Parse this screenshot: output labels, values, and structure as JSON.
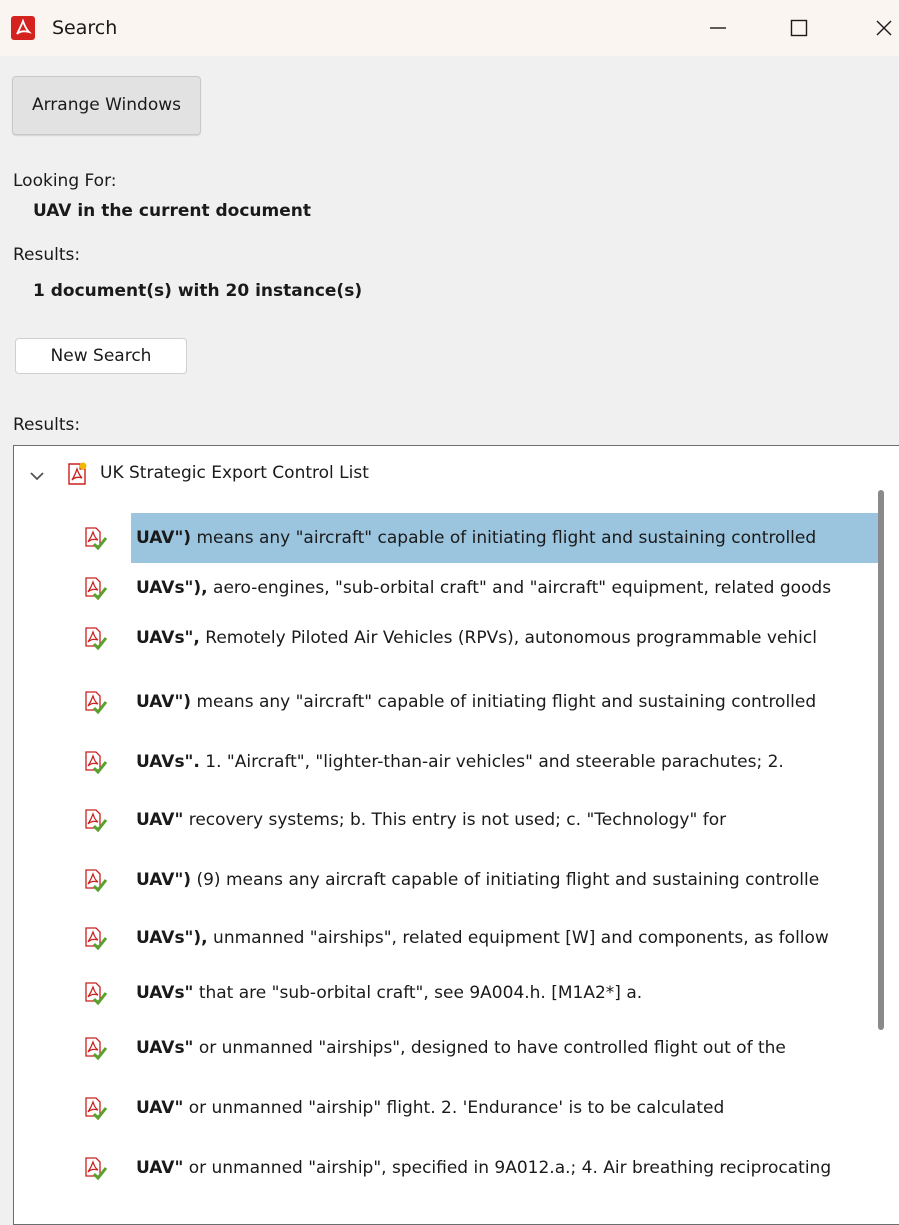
{
  "window": {
    "title": "Search",
    "controls": {
      "minimize": "minimize",
      "maximize": "maximize",
      "close": "close"
    }
  },
  "toolbar": {
    "arrange_label": "Arrange Windows"
  },
  "looking_for": {
    "label": "Looking For:",
    "value": "UAV in the current document"
  },
  "summary": {
    "label": "Results:",
    "value": "1 document(s) with 20 instance(s)"
  },
  "new_search_label": "New Search",
  "results": {
    "label": "Results:",
    "document": "UK Strategic Export Control List",
    "items": [
      {
        "match": "UAV\")",
        "context": " means any \"aircraft\" capable of initiating flight and sustaining controlled"
      },
      {
        "match": "UAVs\"),",
        "context": " aero-engines, \"sub-orbital craft\" and \"aircraft\" equipment, related goods"
      },
      {
        "match": "UAVs\",",
        "context": " Remotely Piloted Air Vehicles (RPVs), autonomous programmable vehicl"
      },
      {
        "match": "UAV\")",
        "context": " means any \"aircraft\" capable of initiating flight and sustaining controlled"
      },
      {
        "match": "UAVs\".",
        "context": " 1. \"Aircraft\", \"lighter-than-air vehicles\" and steerable parachutes; 2."
      },
      {
        "match": "UAV\"",
        "context": " recovery systems; b. This entry is not used; c. \"Technology\" for"
      },
      {
        "match": "UAV\")",
        "context": " (9) means any aircraft capable of initiating flight and sustaining controlle"
      },
      {
        "match": "UAVs\"),",
        "context": " unmanned \"airships\", related equipment [W] and components, as follow"
      },
      {
        "match": "UAVs\"",
        "context": " that are \"sub-orbital craft\", see 9A004.h. [M1A2*] a."
      },
      {
        "match": "UAVs\"",
        "context": " or unmanned \"airships\", designed to have controlled flight out of the"
      },
      {
        "match": "UAV\"",
        "context": " or unmanned \"airship\" flight. 2. 'Endurance' is to be calculated"
      },
      {
        "match": "UAV\"",
        "context": " or unmanned \"airship\", specified in 9A012.a.; 4. Air breathing reciprocating"
      }
    ]
  },
  "colors": {
    "selection": "#9bc4de",
    "acrobat_red": "#d4231e",
    "check_green": "#5aa02c"
  },
  "icons": [
    "acrobat-icon",
    "chevron-down-icon",
    "pdf-document-icon",
    "search-result-icon"
  ]
}
